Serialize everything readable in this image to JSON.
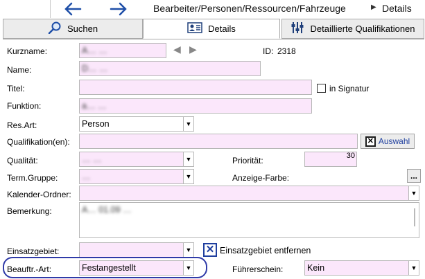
{
  "nav": {
    "back_icon": "arrow-left-icon",
    "forward_icon": "arrow-right-icon",
    "breadcrumb_path": "Bearbeiter/Personen/Ressourcen/Fahrzeuge",
    "breadcrumb_sep_icon": "triangle-right-icon",
    "breadcrumb_current": "Details"
  },
  "tabs": [
    {
      "label": "Suchen",
      "icon": "search-icon"
    },
    {
      "label": "Details",
      "icon": "id-card-icon"
    },
    {
      "label": "Detaillierte Qualifikationen",
      "icon": "sliders-icon"
    }
  ],
  "form": {
    "kurzname": {
      "label": "Kurzname:",
      "value": "A… …"
    },
    "id": {
      "label": "ID:",
      "value": "2318"
    },
    "name": {
      "label": "Name:",
      "value": "D… …"
    },
    "titel": {
      "label": "Titel:",
      "value": ""
    },
    "signatur": {
      "label": "in Signatur",
      "checked": false
    },
    "funktion": {
      "label": "Funktion:",
      "value": "a… …"
    },
    "resart": {
      "label": "Res.Art:",
      "value": "Person"
    },
    "qualifikation": {
      "label": "Qualifikation(en):",
      "value": ""
    },
    "auswahl": {
      "label": "Auswahl",
      "checked": true
    },
    "qualitaet": {
      "label": "Qualität:",
      "value": "… …"
    },
    "prioritaet": {
      "label": "Priorität:",
      "value": "30"
    },
    "termgruppe": {
      "label": "Term.Gruppe:",
      "value": "…"
    },
    "anzeigefarbe": {
      "label": "Anzeige-Farbe:",
      "button": "..."
    },
    "kalender": {
      "label": "Kalender-Ordner:",
      "value": ""
    },
    "bemerkung": {
      "label": "Bemerkung:",
      "value": "A… 01.09 …"
    },
    "einsatzgebiet": {
      "label": "Einsatzgebiet:",
      "value": ""
    },
    "einsatz_entfernen": {
      "label": "Einsatzgebiet entfernen",
      "checked": true
    },
    "beauftrart": {
      "label": "Beauftr.-Art:",
      "value": "Festangestellt"
    },
    "fuehrerschein": {
      "label": "Führerschein:",
      "value": "Kein"
    }
  },
  "colors": {
    "field_bg": "#fbe7fb",
    "nav_blue": "#1f4fa8",
    "annotation": "#2f3aa8"
  }
}
